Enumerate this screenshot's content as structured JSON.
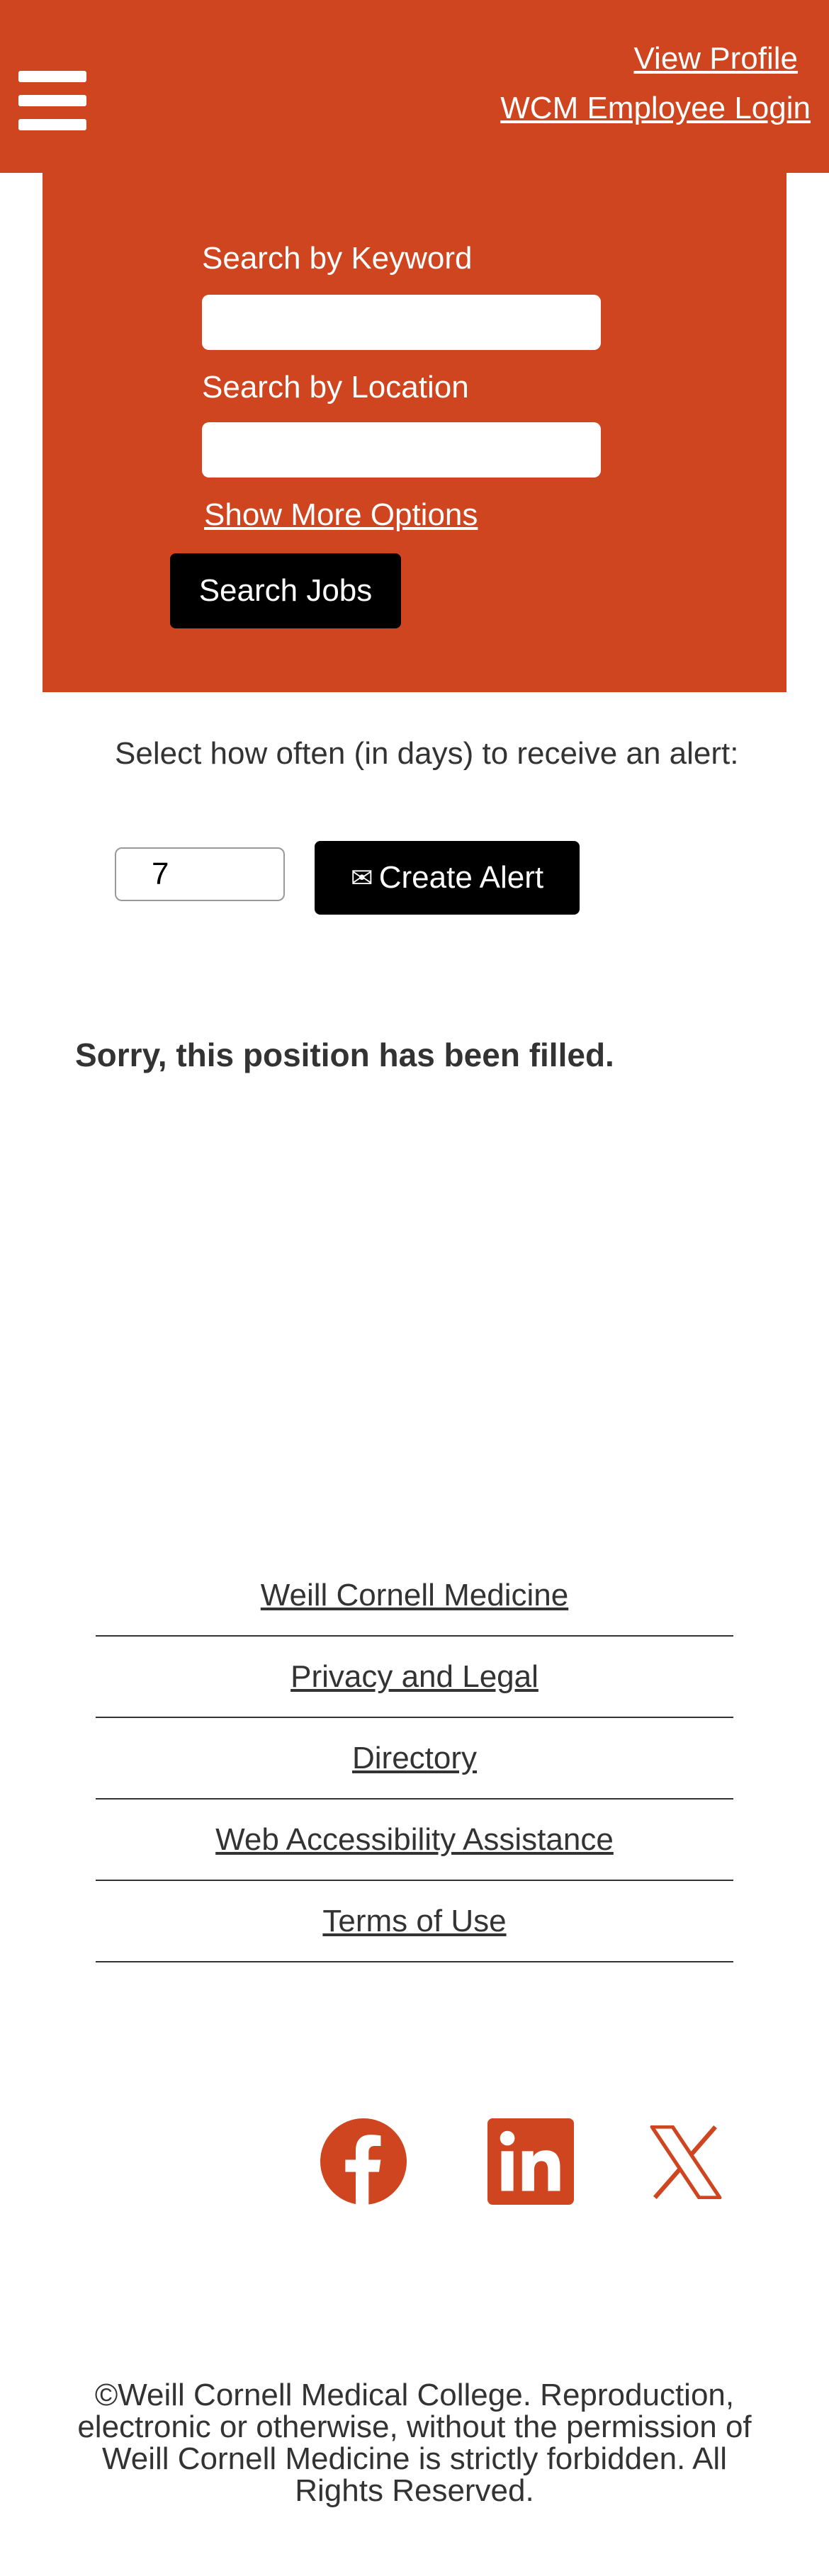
{
  "header": {
    "menu_icon": "hamburger-menu-icon",
    "view_profile": "View Profile",
    "employee_login": "WCM Employee Login",
    "brand_color": "#cf4520"
  },
  "search": {
    "keyword_label": "Search by Keyword",
    "keyword_value": "",
    "location_label": "Search by Location",
    "location_value": "",
    "more_options": "Show More Options",
    "submit_label": "Search Jobs"
  },
  "alert": {
    "prompt": "Select how often (in days) to receive an alert:",
    "days_value": "7",
    "button_icon": "envelope-icon",
    "button_label": "Create Alert"
  },
  "message": {
    "text": "Sorry, this position has been filled."
  },
  "footer": {
    "links": [
      {
        "label": "Weill Cornell Medicine"
      },
      {
        "label": "Privacy and Legal"
      },
      {
        "label": "Directory"
      },
      {
        "label": "Web Accessibility Assistance"
      },
      {
        "label": "Terms of Use"
      }
    ],
    "social": [
      "facebook-icon",
      "linkedin-icon",
      "x-icon"
    ],
    "copyright": "©Weill Cornell Medical College. Reproduction, electronic or otherwise, without the permission of Weill Cornell Medicine is strictly forbidden. All Rights Reserved."
  }
}
